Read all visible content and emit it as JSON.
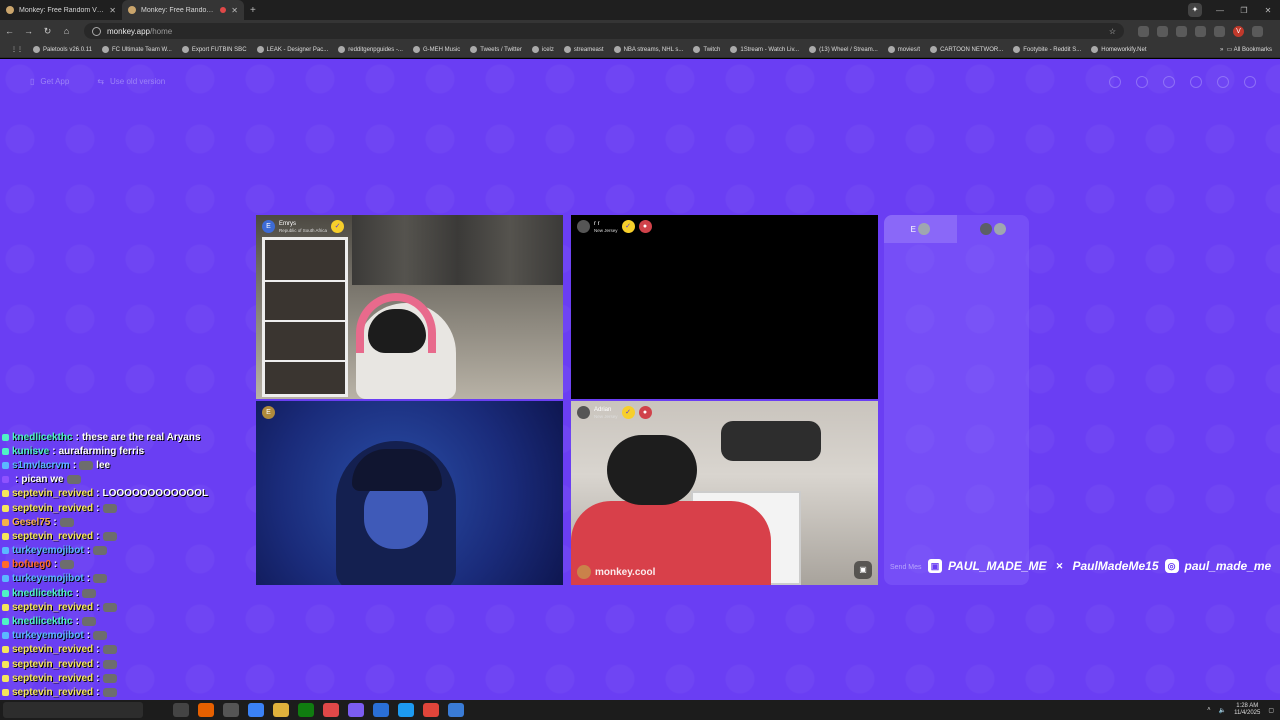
{
  "browser": {
    "tabs": [
      {
        "title": "Monkey: Free Random Video C",
        "active": false
      },
      {
        "title": "Monkey: Free Random Vid",
        "active": true
      }
    ],
    "url_host": "monkey.app",
    "url_path": "/home",
    "bookmarks": [
      "Paletools v26.0.11",
      "FC Ultimate Team W...",
      "Export FUTBIN SBC",
      "LEAK - Designer Pac...",
      "redditgenpguides -...",
      "G-MEH Music",
      "Tweets / Twitter",
      "icelz",
      "streameast",
      "NBA streams, NHL s...",
      "Twitch",
      "1Stream - Watch Liv...",
      "(13) Wheel / Stream...",
      "movies/t",
      "CARTOON NETWOR...",
      "Footybite - Reddit S...",
      "Homeworkify.Net"
    ],
    "all_bookmarks": "All Bookmarks",
    "profile_initial": "V"
  },
  "page": {
    "get_app": "Get App",
    "old_version": "Use old version",
    "accent": "#6a3ef3"
  },
  "videos": {
    "tile1": {
      "avatar": "E",
      "name": "Emrys",
      "location": "Republic of South Africa"
    },
    "tile2": {
      "name": "r r",
      "location": "New Jersey"
    },
    "tile3": {
      "avatar": "E"
    },
    "tile4": {
      "name": "Adrian",
      "location": "New Jersey",
      "watermark": "monkey.cool"
    }
  },
  "side_panel": {
    "tab1_initial": "E",
    "send_placeholder": "Send Mes"
  },
  "socials": {
    "twitch": "PAUL_MADE_ME",
    "x": "PaulMadeMe15",
    "instagram": "paul_made_me"
  },
  "chat": [
    {
      "user": "knedlicekthc",
      "color": "#4ff2c6",
      "msg": "these are the real Aryans",
      "cut": true
    },
    {
      "user": "kunisve",
      "color": "#4ff2c6",
      "msg": "aurafarming ferris"
    },
    {
      "user": "s1mvlacrvm",
      "color": "#5bb7ff",
      "msg": "lee",
      "emote": true
    },
    {
      "user": "",
      "color": "#8f52ff",
      "msg": "pican we",
      "emote_after": true
    },
    {
      "user": "septevin_revived",
      "color": "#f5e65c",
      "msg": "LOOOOOOOOOOOOL"
    },
    {
      "user": "septevin_revived",
      "color": "#f5e65c",
      "msg": "",
      "emote": true
    },
    {
      "user": "Gesel75",
      "color": "#f5b04a",
      "msg": "",
      "emote": true
    },
    {
      "user": "septevin_revived",
      "color": "#f5e65c",
      "msg": "",
      "emote": true
    },
    {
      "user": "turkeyemojibot",
      "color": "#5bb7ff",
      "msg": "",
      "emote": true
    },
    {
      "user": "bofueg0",
      "color": "#ff6a2a",
      "msg": "",
      "emote": true
    },
    {
      "user": "turkeyemojibot",
      "color": "#5bb7ff",
      "msg": "",
      "emote": true
    },
    {
      "user": "knedlicekthc",
      "color": "#4ff2c6",
      "msg": "",
      "emote": true
    },
    {
      "user": "septevin_revived",
      "color": "#f5e65c",
      "msg": "",
      "emote": true
    },
    {
      "user": "knedlicekthc",
      "color": "#4ff2c6",
      "msg": "",
      "emote": true
    },
    {
      "user": "turkeyemojibot",
      "color": "#5bb7ff",
      "msg": "",
      "emote": true
    },
    {
      "user": "septevin_revived",
      "color": "#f5e65c",
      "msg": "",
      "emote": true
    },
    {
      "user": "septevin_revived",
      "color": "#f5e65c",
      "msg": "",
      "emote": true
    },
    {
      "user": "septevin_revived",
      "color": "#f5e65c",
      "msg": "",
      "emote": true
    },
    {
      "user": "septevin_revived",
      "color": "#f5e65c",
      "msg": "",
      "emote": true
    }
  ],
  "taskbar": {
    "time": "1:28 AM",
    "date": "11/4/2025",
    "overlay_user": "turkeyemojibot"
  }
}
